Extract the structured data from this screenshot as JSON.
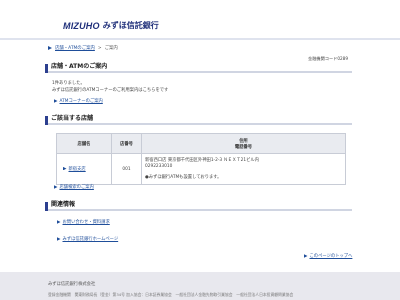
{
  "header": {
    "logo_en": "MIZUHO",
    "logo_jp": "みずほ信託銀行"
  },
  "breadcrumb": {
    "home": "店舗・ATMのご案内",
    "current": "ご案内"
  },
  "bank_code": "金融機関コード0289",
  "section1": {
    "title": "店舗・ATMのご案内",
    "line1": "1件ありました。",
    "line2": "みずほ信託銀行のATMコーナーのご利用案内はこちらをです",
    "atm_link": "ATMコーナーのご案内"
  },
  "section2": {
    "title": "ご該当する店舗",
    "table": {
      "headers": {
        "name": "店舗名",
        "number": "店番号",
        "address": "住所",
        "phone": "電話番号"
      },
      "rows": [
        {
          "name": "新宿支店",
          "number": "001",
          "address": "新宿西口店 東京都千代田区外神田1-2-3 ＮＥＸＴ21ビル内",
          "phone": "0292233010",
          "note": "●みずほ銀行ATMも設置しております。"
        }
      ]
    },
    "search_link": "店舗検索のご案内"
  },
  "section3": {
    "title": "関連情報",
    "links": [
      "お問い合わせ・資料請求",
      "みずほ信託銀行ホームページ"
    ],
    "page_top": "このページのトップへ"
  },
  "footer": {
    "company": "みずほ信託銀行株式会社",
    "info": "登録金融機関　関東財務局長（登金）第34号 加入協会：日本証券業協会　一般社団法人金融先物取引業協会　一般社団法人日本投資顧問業協会"
  }
}
